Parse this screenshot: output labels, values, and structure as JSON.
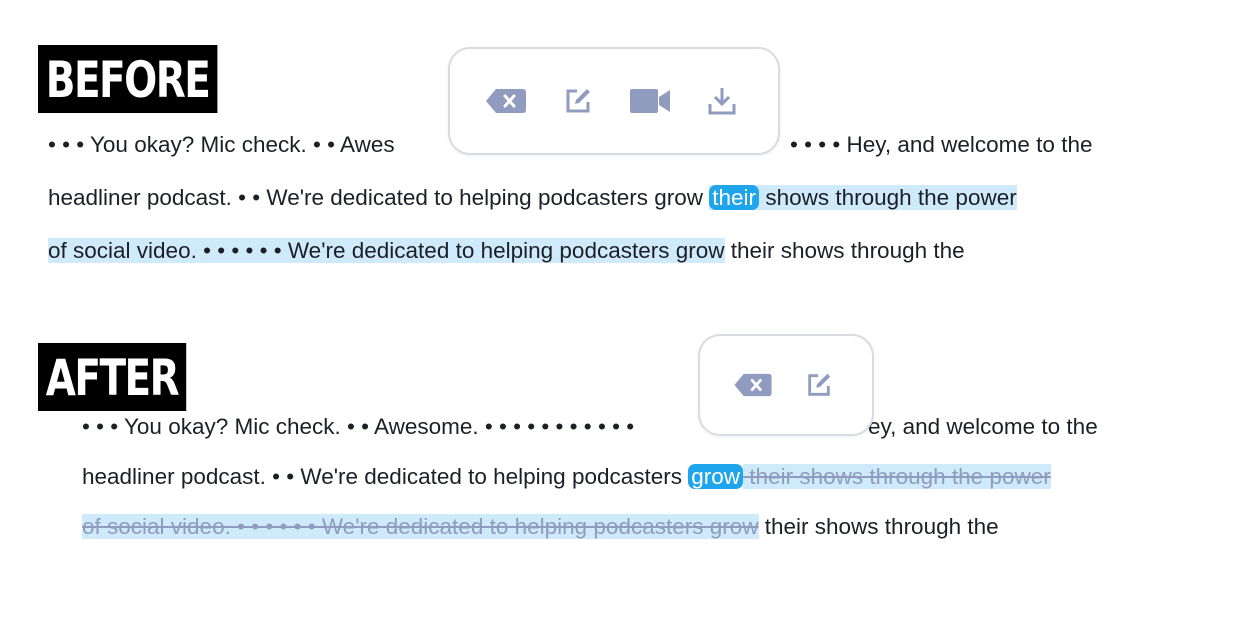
{
  "labels": {
    "before": "BEFORE",
    "after": "AFTER"
  },
  "colors": {
    "highlight": "#cfebfb",
    "chip": "#1fa5ec",
    "icon": "#8f9bbf",
    "strike_text": "#8f9bbf"
  },
  "toolbar_before": {
    "icons": [
      "delete-icon",
      "edit-icon",
      "video-icon",
      "download-icon"
    ]
  },
  "toolbar_after": {
    "icons": [
      "delete-icon",
      "edit-icon"
    ]
  },
  "before": {
    "line1_a": "• • • You okay? Mic check. • • Awes",
    "line1_b": "• • • • Hey, and welcome to the",
    "line2_a": "headliner podcast. • • We're dedicated to helping podcasters grow ",
    "line2_chip": "their",
    "line2_hl": " shows through the power",
    "line3_hl": "of social video. • • • • • • We're dedicated to helping podcasters grow",
    "line3_b": " their shows through the"
  },
  "after": {
    "line1_a": "• • • You okay? Mic check. • • Awesome. • • • • • • • • • • •",
    "line1_b": "ey, and welcome to the",
    "line2_a": "headliner podcast. • • We're dedicated to helping podcasters ",
    "line2_chip": "grow",
    "line2_strike": " their shows through the power",
    "line3_strike": "of social video. • • • • • • We're dedicated to helping podcasters grow",
    "line3_b": " their shows through the"
  }
}
